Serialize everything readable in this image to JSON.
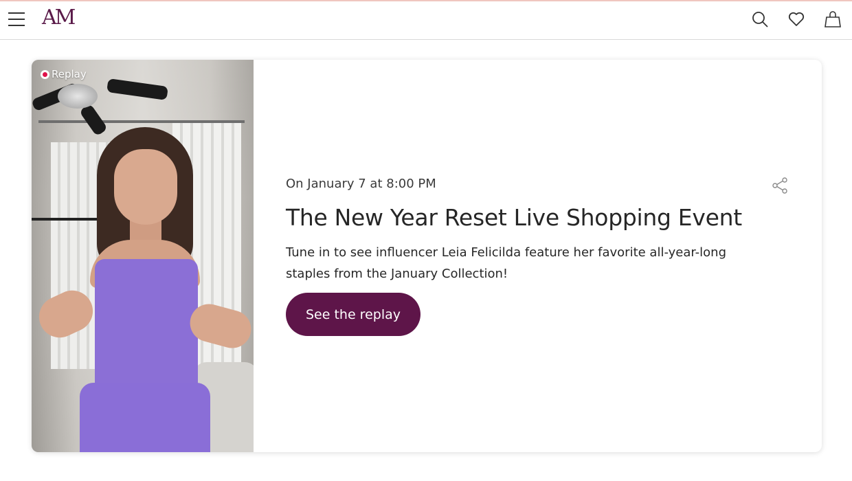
{
  "header": {
    "logo": "AM",
    "icons": [
      "menu-icon",
      "search-icon",
      "heart-icon",
      "shopping-bag-icon"
    ]
  },
  "event": {
    "badge": "Replay",
    "date": "On January 7 at 8:00 PM",
    "title": "The New Year Reset Live Shopping Event",
    "description": "Tune in to see influencer Leia Felicilda feature her favorite all-year-long staples from the January Collection!",
    "cta_label": "See the replay"
  },
  "colors": {
    "brand": "#5e1549",
    "replay_dot": "#e0124a",
    "top_accent": "#f0c6bf"
  }
}
